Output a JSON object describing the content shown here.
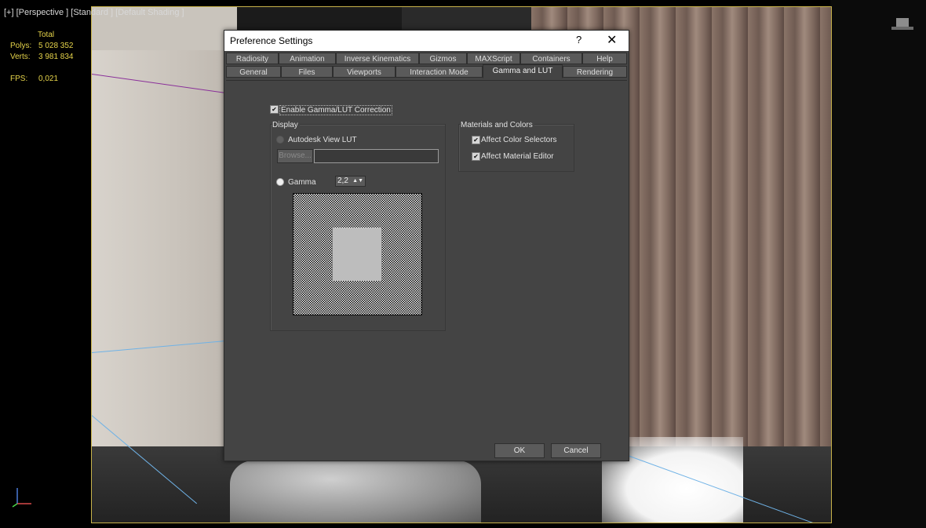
{
  "viewport": {
    "label": "[+] [Perspective ] [Standard ] [Default Shading ]",
    "stats": {
      "header": "Total",
      "polys_label": "Polys:",
      "polys": "5 028 352",
      "verts_label": "Verts:",
      "verts": "3 981 834",
      "fps_label": "FPS:",
      "fps": "0,021"
    }
  },
  "dialog": {
    "title": "Preference Settings",
    "help": "?",
    "close": "✕",
    "tabs_row1": [
      "Radiosity",
      "Animation",
      "Inverse Kinematics",
      "Gizmos",
      "MAXScript",
      "Containers",
      "Help"
    ],
    "tabs_row2": [
      "General",
      "Files",
      "Viewports",
      "Interaction Mode",
      "Gamma and LUT",
      "Rendering"
    ],
    "active_tab": "Gamma and LUT",
    "enable_gamma": {
      "label": "Enable Gamma/LUT Correction",
      "checked": true
    },
    "display": {
      "title": "Display",
      "lut_label": "Autodesk View LUT",
      "browse_label": "Browse...",
      "lut_path": "",
      "gamma_label": "Gamma",
      "gamma_value": "2,2"
    },
    "materials": {
      "title": "Materials and Colors",
      "affect_color_selectors": {
        "label": "Affect Color Selectors",
        "checked": true
      },
      "affect_material_editor": {
        "label": "Affect Material Editor",
        "checked": true
      }
    },
    "ok_label": "OK",
    "cancel_label": "Cancel"
  }
}
